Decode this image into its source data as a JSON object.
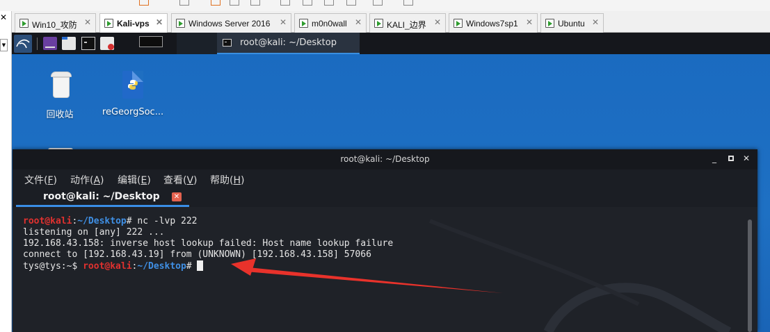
{
  "vm_tabs": [
    {
      "label": "Win10_攻防",
      "active": false
    },
    {
      "label": "Kali-vps",
      "active": true
    },
    {
      "label": "Windows Server 2016",
      "active": false
    },
    {
      "label": "m0n0wall",
      "active": false
    },
    {
      "label": "KALI_边界",
      "active": false
    },
    {
      "label": "Windows7sp1",
      "active": false
    },
    {
      "label": "Ubuntu",
      "active": false
    }
  ],
  "vm_tab_close_glyph": "✕",
  "left_panel": {
    "close_glyph": "✕"
  },
  "kali_panel": {
    "task_label": "root@kali: ~/Desktop"
  },
  "desktop_icons": [
    {
      "label": "回收站",
      "icon": "trash-icon"
    },
    {
      "label": "reGeorgSoc...",
      "icon": "python-file-icon"
    }
  ],
  "terminal": {
    "title": "root@kali: ~/Desktop",
    "window_controls": {
      "minimize": "_",
      "close": "✕"
    },
    "menu": [
      {
        "text": "文件(",
        "key": "F",
        "suffix": ")"
      },
      {
        "text": "动作(",
        "key": "A",
        "suffix": ")"
      },
      {
        "text": "编辑(",
        "key": "E",
        "suffix": ")"
      },
      {
        "text": "查看(",
        "key": "V",
        "suffix": ")"
      },
      {
        "text": "帮助(",
        "key": "H",
        "suffix": ")"
      }
    ],
    "tab_label": "root@kali: ~/Desktop",
    "tab_close": "✕",
    "prompt": {
      "user": "root@kali",
      "colon": ":",
      "path": "~/Desktop",
      "symbol": "#"
    },
    "line1_command": " nc -lvp 222",
    "lines": [
      "listening on [any] 222 ...",
      "192.168.43.158: inverse host lookup failed: Host name lookup failure",
      "connect to [192.168.43.19] from (UNKNOWN) [192.168.43.158] 57066"
    ],
    "remote_prompt": "tys@tys:~$ ",
    "annotation_color": "#e8322b"
  }
}
